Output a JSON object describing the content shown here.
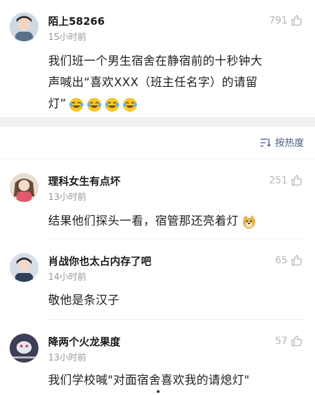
{
  "comments": [
    {
      "username": "陌上58266",
      "time": "15小时前",
      "likes": "791",
      "text_lines": [
        "我们班一个男生宿舍在静宿前的十秒钟大",
        "声喊出“喜欢XXX（班主任名字）的请留",
        "灯”"
      ]
    },
    {
      "username": "理科女生有点坏",
      "time": "13小时前",
      "likes": "251",
      "text": "结果他们探头一看，宿管那还亮着灯"
    },
    {
      "username": "肖战你也太占内存了吧",
      "time": "14小时前",
      "likes": "65",
      "text": "敬他是条汉子"
    },
    {
      "username": "降两个火龙果度",
      "time": "13小时前",
      "likes": "57",
      "text": "我们学校喊\"对面宿舍喜欢我的请熄灯\""
    }
  ],
  "sort": {
    "label": "按热度"
  },
  "icons": {
    "like": "thumbs-up-icon",
    "sort": "sort-lines-icon",
    "laugh": "laughing-tears-emoji",
    "doge": "doge-emoji"
  },
  "colors": {
    "link": "#4a5f88",
    "muted": "#9a9a9a",
    "band": "#f1f1f1"
  }
}
